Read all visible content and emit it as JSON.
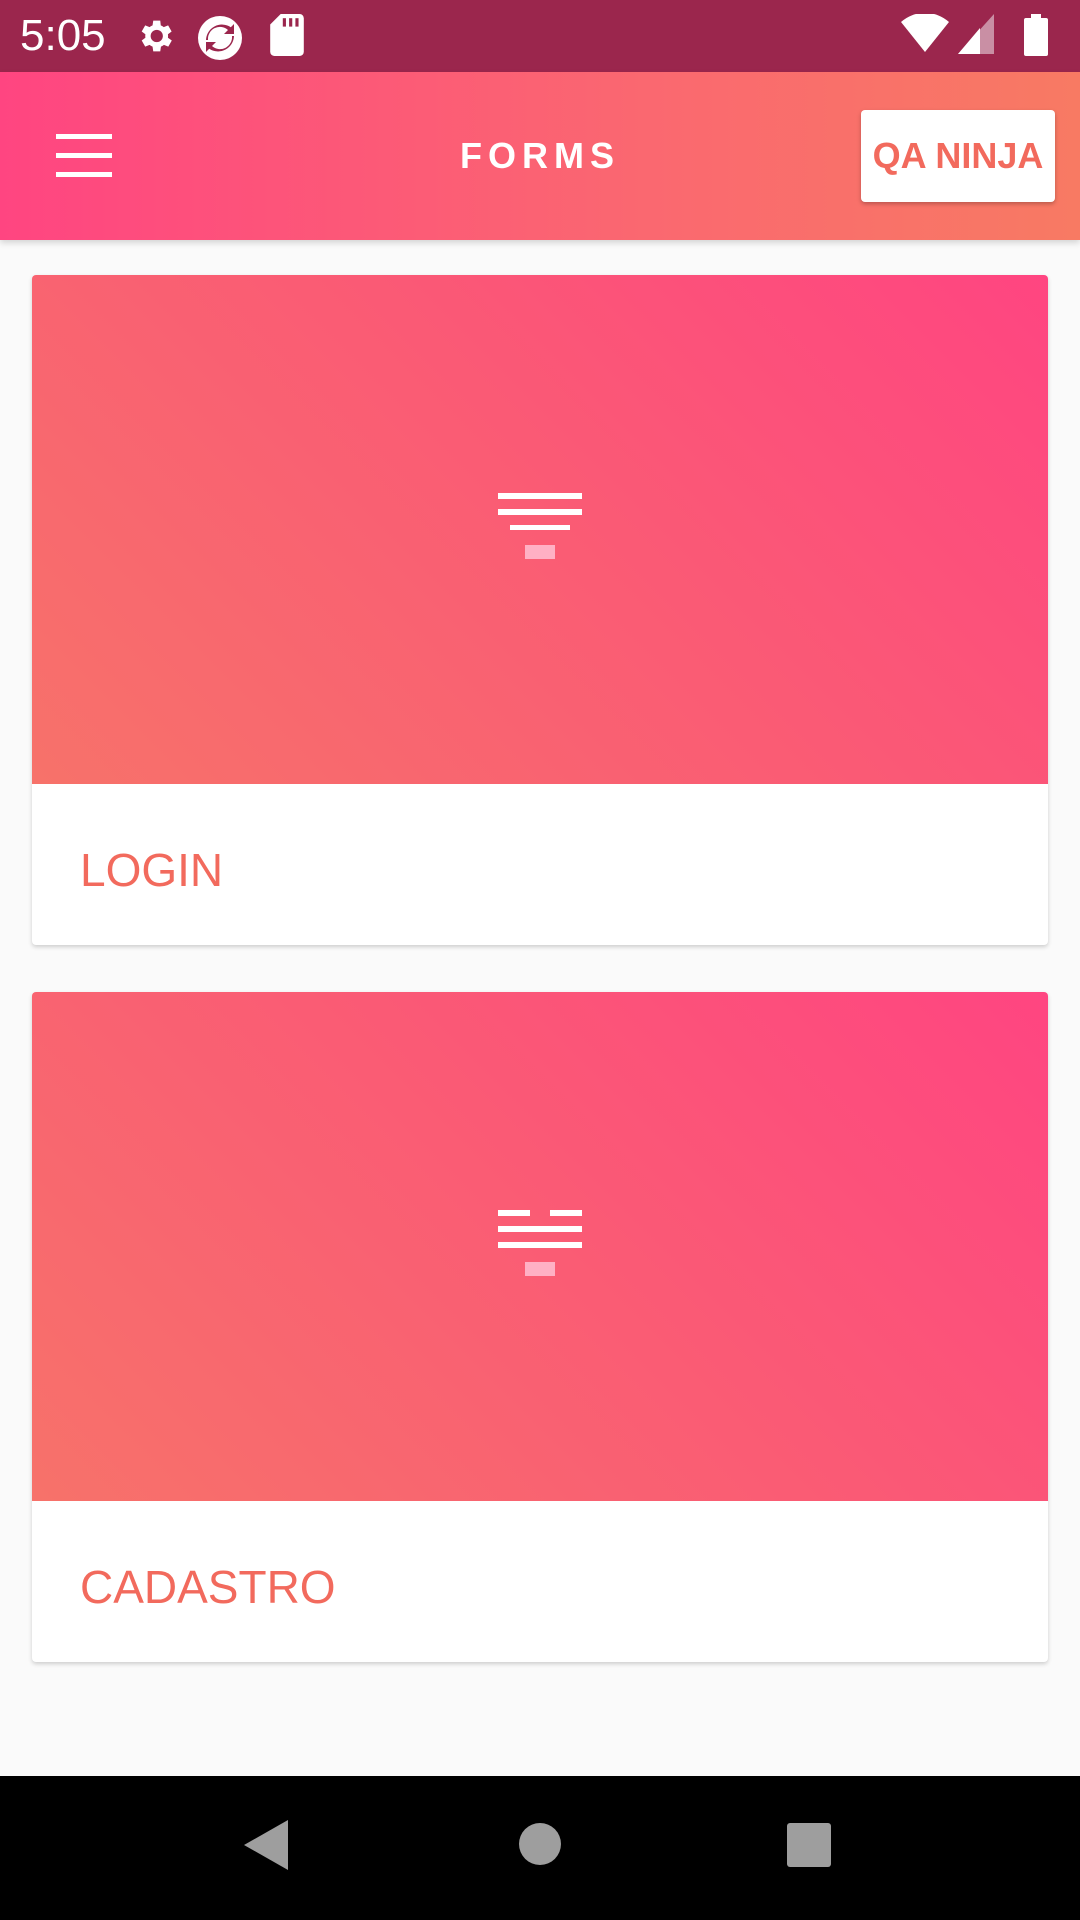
{
  "status_bar": {
    "time": "5:05",
    "icons_left": [
      "gear-icon",
      "sync-app-icon",
      "sd-card-icon"
    ],
    "icons_right": [
      "wifi-icon",
      "cell-signal-icon",
      "battery-icon"
    ],
    "background": "#9b264d"
  },
  "app_bar": {
    "title": "FORMS",
    "menu_icon": "hamburger-menu-icon",
    "action_label": "QA NINJA",
    "gradient": [
      "#ff4581",
      "#f87a63"
    ]
  },
  "cards": [
    {
      "label": "LOGIN",
      "icon": "form-lines-icon"
    },
    {
      "label": "CADASTRO",
      "icon": "form-split-lines-icon"
    }
  ],
  "nav_bar": {
    "buttons": [
      "back-icon",
      "home-icon",
      "recents-icon"
    ]
  },
  "colors": {
    "accent_text": "#f26a5d",
    "page_bg": "#fafafa"
  }
}
